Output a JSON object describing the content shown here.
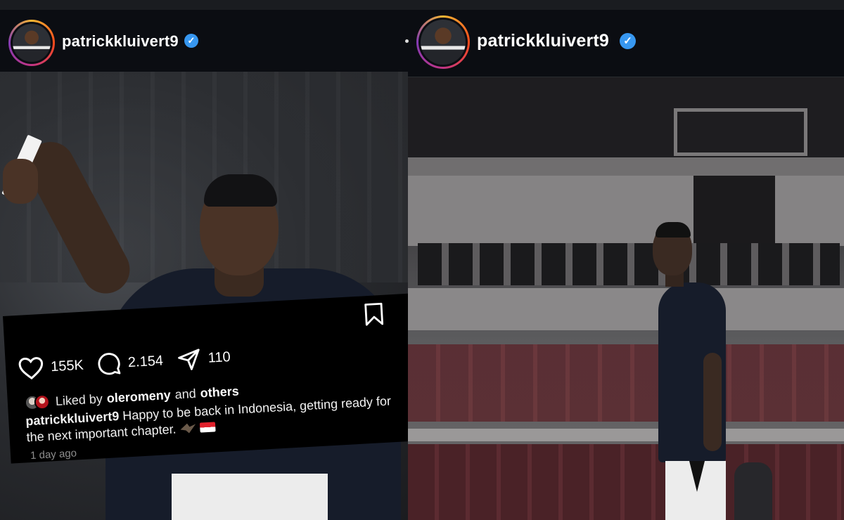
{
  "left_post": {
    "username": "patrickkluivert9",
    "verified_mark": "✓",
    "actions": {
      "likes": "155K",
      "comments": "2.154",
      "shares": "110"
    },
    "liked_by": {
      "prefix": "Liked by",
      "user": "oleromeny",
      "and": "and",
      "others": "others"
    },
    "caption": {
      "username": "patrickkluivert9",
      "text": "Happy to be back in Indonesia, getting ready for the next important chapter."
    },
    "time": "1 day ago"
  },
  "right_post": {
    "username": "patrickkluivert9",
    "verified_mark": "✓"
  },
  "icons": [
    "heart-icon",
    "comment-icon",
    "share-icon",
    "bookmark-icon",
    "verified-icon"
  ],
  "colors": {
    "verified": "#3797f0",
    "background": "#0b0d12",
    "caption_bg": "#000000",
    "muted_text": "#8e8e8e"
  }
}
